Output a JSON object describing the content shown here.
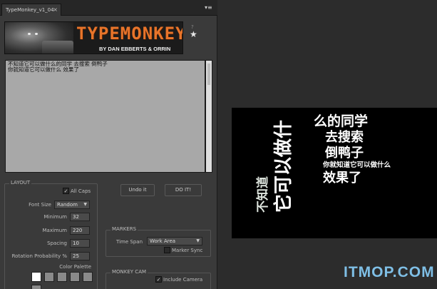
{
  "panel": {
    "tab_title": "TypeMonkey_v1_04",
    "tab_close": "×",
    "menu_icon": "▾≡"
  },
  "banner": {
    "title": "TYPEMONKEY",
    "subtitle": "BY DAN EBBERTS & ORRIN ZUCKER",
    "help": "?",
    "star": "★",
    "title_color": "#e8742a"
  },
  "text_area": {
    "line1": "不知道它可以做什么的同学 去搜索 倒鸭子",
    "line2": "你就知道它可以做什么 效果了"
  },
  "layout": {
    "group_title": "LAYOUT",
    "all_caps_label": "All Caps",
    "all_caps_checked": "✓",
    "font_size_label": "Font Size",
    "font_size_value": "Random",
    "minimum_label": "Minimum",
    "minimum_value": "32",
    "maximum_label": "Maximum",
    "maximum_value": "220",
    "spacing_label": "Spacing",
    "spacing_value": "10",
    "rotation_label": "Rotation Probability %",
    "rotation_value": "25",
    "color_palette_label": "Color Palette",
    "swatches": [
      "#ffffff",
      "#8a8a8a",
      "#8a8a8a",
      "#8a8a8a",
      "#8a8a8a",
      "#8a8a8a"
    ]
  },
  "actions": {
    "undo_label": "Undo it",
    "do_label": "DO IT!"
  },
  "markers": {
    "group_title": "MARKERS",
    "time_span_label": "Time Span",
    "time_span_value": "Work Area",
    "marker_sync_label": "Marker Sync"
  },
  "monkey_cam": {
    "group_title": "MONKEY CAM",
    "include_camera_label": "Include Camera",
    "include_camera_checked": "✓"
  },
  "preview": {
    "line1": "么的同学",
    "line2": "去搜索",
    "line3": "倒鸭子",
    "line4": "你就知道它可以做什么",
    "line5": "效果了",
    "vertical_big": "它可以做什",
    "vertical_small": "不知道"
  },
  "watermark": "ITMOP.COM"
}
